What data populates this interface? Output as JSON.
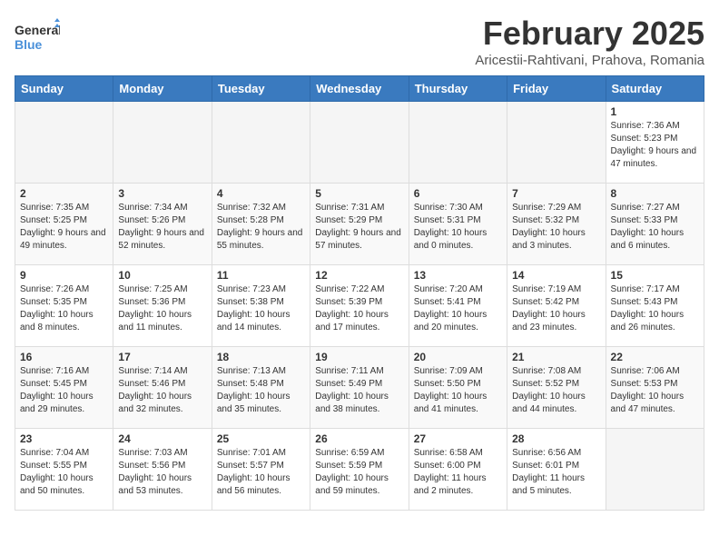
{
  "header": {
    "logo_line1": "General",
    "logo_line2": "Blue",
    "title": "February 2025",
    "subtitle": "Aricestii-Rahtivani, Prahova, Romania"
  },
  "weekdays": [
    "Sunday",
    "Monday",
    "Tuesday",
    "Wednesday",
    "Thursday",
    "Friday",
    "Saturday"
  ],
  "weeks": [
    [
      {
        "day": "",
        "info": ""
      },
      {
        "day": "",
        "info": ""
      },
      {
        "day": "",
        "info": ""
      },
      {
        "day": "",
        "info": ""
      },
      {
        "day": "",
        "info": ""
      },
      {
        "day": "",
        "info": ""
      },
      {
        "day": "1",
        "info": "Sunrise: 7:36 AM\nSunset: 5:23 PM\nDaylight: 9 hours and 47 minutes."
      }
    ],
    [
      {
        "day": "2",
        "info": "Sunrise: 7:35 AM\nSunset: 5:25 PM\nDaylight: 9 hours and 49 minutes."
      },
      {
        "day": "3",
        "info": "Sunrise: 7:34 AM\nSunset: 5:26 PM\nDaylight: 9 hours and 52 minutes."
      },
      {
        "day": "4",
        "info": "Sunrise: 7:32 AM\nSunset: 5:28 PM\nDaylight: 9 hours and 55 minutes."
      },
      {
        "day": "5",
        "info": "Sunrise: 7:31 AM\nSunset: 5:29 PM\nDaylight: 9 hours and 57 minutes."
      },
      {
        "day": "6",
        "info": "Sunrise: 7:30 AM\nSunset: 5:31 PM\nDaylight: 10 hours and 0 minutes."
      },
      {
        "day": "7",
        "info": "Sunrise: 7:29 AM\nSunset: 5:32 PM\nDaylight: 10 hours and 3 minutes."
      },
      {
        "day": "8",
        "info": "Sunrise: 7:27 AM\nSunset: 5:33 PM\nDaylight: 10 hours and 6 minutes."
      }
    ],
    [
      {
        "day": "9",
        "info": "Sunrise: 7:26 AM\nSunset: 5:35 PM\nDaylight: 10 hours and 8 minutes."
      },
      {
        "day": "10",
        "info": "Sunrise: 7:25 AM\nSunset: 5:36 PM\nDaylight: 10 hours and 11 minutes."
      },
      {
        "day": "11",
        "info": "Sunrise: 7:23 AM\nSunset: 5:38 PM\nDaylight: 10 hours and 14 minutes."
      },
      {
        "day": "12",
        "info": "Sunrise: 7:22 AM\nSunset: 5:39 PM\nDaylight: 10 hours and 17 minutes."
      },
      {
        "day": "13",
        "info": "Sunrise: 7:20 AM\nSunset: 5:41 PM\nDaylight: 10 hours and 20 minutes."
      },
      {
        "day": "14",
        "info": "Sunrise: 7:19 AM\nSunset: 5:42 PM\nDaylight: 10 hours and 23 minutes."
      },
      {
        "day": "15",
        "info": "Sunrise: 7:17 AM\nSunset: 5:43 PM\nDaylight: 10 hours and 26 minutes."
      }
    ],
    [
      {
        "day": "16",
        "info": "Sunrise: 7:16 AM\nSunset: 5:45 PM\nDaylight: 10 hours and 29 minutes."
      },
      {
        "day": "17",
        "info": "Sunrise: 7:14 AM\nSunset: 5:46 PM\nDaylight: 10 hours and 32 minutes."
      },
      {
        "day": "18",
        "info": "Sunrise: 7:13 AM\nSunset: 5:48 PM\nDaylight: 10 hours and 35 minutes."
      },
      {
        "day": "19",
        "info": "Sunrise: 7:11 AM\nSunset: 5:49 PM\nDaylight: 10 hours and 38 minutes."
      },
      {
        "day": "20",
        "info": "Sunrise: 7:09 AM\nSunset: 5:50 PM\nDaylight: 10 hours and 41 minutes."
      },
      {
        "day": "21",
        "info": "Sunrise: 7:08 AM\nSunset: 5:52 PM\nDaylight: 10 hours and 44 minutes."
      },
      {
        "day": "22",
        "info": "Sunrise: 7:06 AM\nSunset: 5:53 PM\nDaylight: 10 hours and 47 minutes."
      }
    ],
    [
      {
        "day": "23",
        "info": "Sunrise: 7:04 AM\nSunset: 5:55 PM\nDaylight: 10 hours and 50 minutes."
      },
      {
        "day": "24",
        "info": "Sunrise: 7:03 AM\nSunset: 5:56 PM\nDaylight: 10 hours and 53 minutes."
      },
      {
        "day": "25",
        "info": "Sunrise: 7:01 AM\nSunset: 5:57 PM\nDaylight: 10 hours and 56 minutes."
      },
      {
        "day": "26",
        "info": "Sunrise: 6:59 AM\nSunset: 5:59 PM\nDaylight: 10 hours and 59 minutes."
      },
      {
        "day": "27",
        "info": "Sunrise: 6:58 AM\nSunset: 6:00 PM\nDaylight: 11 hours and 2 minutes."
      },
      {
        "day": "28",
        "info": "Sunrise: 6:56 AM\nSunset: 6:01 PM\nDaylight: 11 hours and 5 minutes."
      },
      {
        "day": "",
        "info": ""
      }
    ]
  ]
}
